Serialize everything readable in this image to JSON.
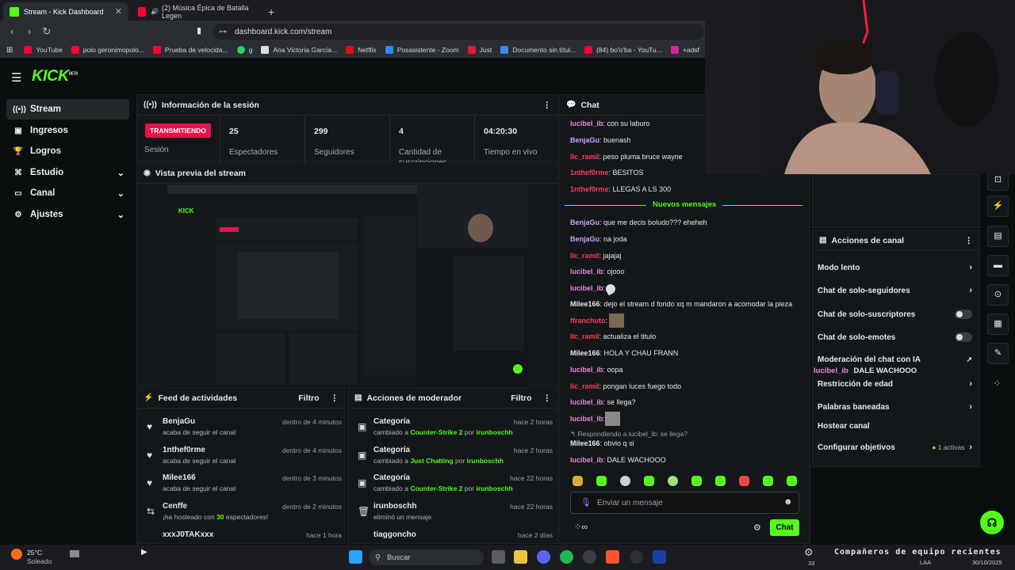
{
  "browser": {
    "tabs": [
      {
        "label": "Stream - Kick Dashboard",
        "active": true
      },
      {
        "label": "(2) Música Épica de Batalla Legen",
        "active": false
      }
    ],
    "url": "dashboard.kick.com/stream",
    "bookmarks": [
      "YouTube",
      "polo geronimopolo...",
      "Prueba de velocida...",
      "g",
      "Ana Victoria García...",
      "Netflix",
      "Posasistente - Zoom",
      "Just",
      "Documento sin títul...",
      "(84) bo'o'ba - YouTu...",
      "+adsf"
    ]
  },
  "logo": "KICK",
  "logo_badge": "BETA",
  "sidebar": {
    "items": [
      {
        "label": "Stream",
        "icon": "broadcast-icon",
        "active": true
      },
      {
        "label": "Ingresos",
        "icon": "wallet-icon"
      },
      {
        "label": "Logros",
        "icon": "trophy-icon"
      },
      {
        "label": "Estudio",
        "icon": "studio-icon",
        "expandable": true
      },
      {
        "label": "Canal",
        "icon": "monitor-icon",
        "expandable": true
      },
      {
        "label": "Ajustes",
        "icon": "gear-icon",
        "expandable": true
      }
    ]
  },
  "session": {
    "title": "Información de la sesión",
    "status_badge": "TRANSMITIENDO",
    "status_label": "Sesión",
    "stats": [
      {
        "value": "25",
        "label": "Espectadores"
      },
      {
        "value": "299",
        "label": "Seguidores"
      },
      {
        "value": "4",
        "label": "Cantidad de suscripciones"
      },
      {
        "value": "04:20:30",
        "label": "Tiempo en vivo"
      }
    ]
  },
  "preview": {
    "title": "Vista previa del stream"
  },
  "feed": {
    "title": "Feed de actividades",
    "filter": "Filtro",
    "items": [
      {
        "name": "BenjaGu",
        "desc": "acaba de seguir el canal",
        "time": "dentro de 4 minutos",
        "icon": "heart-icon"
      },
      {
        "name": "1nthef0rme",
        "desc": "acaba de seguir el canal",
        "time": "dentro de 4 minutos",
        "icon": "heart-icon"
      },
      {
        "name": "Milee166",
        "desc": "acaba de seguir el canal",
        "time": "dentro de 3 minutos",
        "icon": "heart-icon"
      },
      {
        "name": "Cenffe",
        "desc_pre": "¡ha hosteado con ",
        "desc_num": "30",
        "desc_post": " espectadores!",
        "time": "dentro de 2 minutos",
        "icon": "host-icon"
      },
      {
        "name": "xxxJ0TAKxxx",
        "desc": "",
        "time": "hace 1 hora",
        "icon": "gift-icon"
      }
    ]
  },
  "modactions": {
    "title": "Acciones de moderador",
    "filter": "Filtro",
    "items": [
      {
        "name": "Categoría",
        "pre": "cambiado a ",
        "target": "Counter-Strike 2",
        "mid": " por ",
        "by": "irunboschh",
        "time": "hace 2 horas"
      },
      {
        "name": "Categoría",
        "pre": "cambiado a ",
        "target": "Just Chatting",
        "mid": " por ",
        "by": "irunboschh",
        "time": "hace 2 horas"
      },
      {
        "name": "Categoría",
        "pre": "cambiado a ",
        "target": "Counter-Strike 2",
        "mid": " por ",
        "by": "irunboschh",
        "time": "hace 22 horas"
      },
      {
        "name": "irunboschh",
        "pre": "eliminó un mensaje",
        "target": "",
        "mid": "",
        "by": "",
        "time": "hace 22 horas"
      },
      {
        "name": "tiaggoncho",
        "pre": "",
        "target": "",
        "mid": "",
        "by": "",
        "time": "hace 2 días"
      }
    ]
  },
  "chat": {
    "title": "Chat",
    "new_messages": "Nuevos mensajes",
    "messages": [
      {
        "user": "lucibel_ib",
        "color": "#e88ad9",
        "text": "con su laburo"
      },
      {
        "user": "BenjaGu",
        "color": "#c9a3ff",
        "text": "buenash"
      },
      {
        "user": "llc_ramil",
        "color": "#ff3b5c",
        "text": "peso pluma bruce wayne"
      },
      {
        "user": "1nthef0rme",
        "color": "#ff3b5c",
        "text": "BESITOS"
      },
      {
        "user": "1nthef0rme",
        "color": "#ff3b5c",
        "text": "LLEGAS A LS 300"
      },
      {
        "user": "BenjaGu",
        "color": "#c9a3ff",
        "text": "que me decis boludo??? eheheh"
      },
      {
        "user": "BenjaGu",
        "color": "#c9a3ff",
        "text": "na joda"
      },
      {
        "user": "llc_ramil",
        "color": "#ff3b5c",
        "text": "jajajaj"
      },
      {
        "user": "lucibel_ib",
        "color": "#e88ad9",
        "text": "ojooo"
      },
      {
        "user": "lucibel_ib",
        "color": "#e88ad9",
        "text": ""
      },
      {
        "user": "Milee166",
        "color": "#e6e8ea",
        "text": "dejo el stream d fondo xq m mandaron a acomodar la pieza"
      },
      {
        "user": "ffranchuto",
        "color": "#ff3b5c",
        "text": ""
      },
      {
        "user": "llc_ramil",
        "color": "#ff3b5c",
        "text": "actualiza el titulo"
      },
      {
        "user": "Milee166",
        "color": "#e6e8ea",
        "text": "HOLA Y CHAU FRANN"
      },
      {
        "user": "lucibel_ib",
        "color": "#e88ad9",
        "text": "oopa"
      },
      {
        "user": "llc_ramil",
        "color": "#ff3b5c",
        "text": "pongan luces fuego todo"
      },
      {
        "user": "lucibel_ib",
        "color": "#e88ad9",
        "text": "se llega?"
      },
      {
        "user": "lucibel_ib",
        "color": "#e88ad9",
        "text": ""
      },
      {
        "user": "Milee166",
        "color": "#e6e8ea",
        "text": "obvio q si"
      },
      {
        "user": "lucibel_ib",
        "color": "#e88ad9",
        "text": "DALE WACHOOO"
      }
    ],
    "reply_context": "Respondiendo a lucibel_ib: se llega?",
    "input_placeholder": "Enviar un mensaje",
    "send_label": "Chat"
  },
  "channel_actions": {
    "title": "Acciones de canal",
    "items": [
      {
        "label": "Modo lento",
        "control": "chevron"
      },
      {
        "label": "Chat de solo-seguidores",
        "control": "chevron"
      },
      {
        "label": "Chat de solo-suscriptores",
        "control": "toggle"
      },
      {
        "label": "Chat de solo-emotes",
        "control": "toggle"
      },
      {
        "label": "Moderación del chat con IA",
        "control": "external"
      },
      {
        "label": "Restricción de edad",
        "control": "chevron"
      },
      {
        "label": "Palabras baneadas",
        "control": "chevron"
      },
      {
        "label": "Hostear canal",
        "control": "none"
      },
      {
        "label": "Configurar objetivos",
        "control": "chevron",
        "badge": "1 activas"
      }
    ],
    "overlay_user": "lucibel_ib",
    "overlay_text": "DALE WACHOOO"
  },
  "taskbar": {
    "weather_temp": "25°C",
    "weather_desc": "Soleado",
    "search_placeholder": "Buscar",
    "lang": "LAA",
    "date": "30/10/2025",
    "badge_count": "33",
    "overlay_banner": "Compañeros de equipo recientes"
  },
  "colors": {
    "accent": "#53fc18",
    "live": "#e8124f"
  }
}
